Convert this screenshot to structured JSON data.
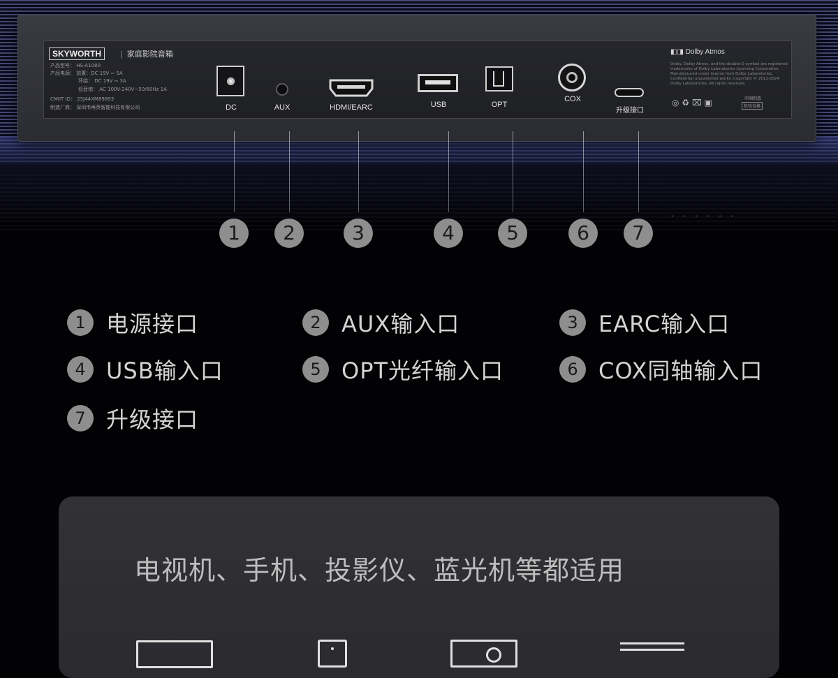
{
  "soundbar": {
    "brand": "SKYWORTH",
    "product_name": "家庭影院音箱",
    "specs": [
      "产品型号：  HS-A1080",
      "产品电源：  前置：DC 19V ⎓ 5A",
      "环绕：  DC 19V ⎓ 3A",
      "低音炮：  AC 100V-240V~50/60Hz 1A",
      "CMIIT ID：  25J44XM89893",
      "制造厂商：  深圳市再英智能科技有限公司"
    ],
    "dolby_logo": "Dolby Atmos",
    "legal_text": "Dolby, Dolby Atmos, and the double-D symbol are registered trademarks of Dolby Laboratories Licensing Corporation. Manufactured under license from Dolby Laboratories. Confidential unpublished works. Copyright © 2012-2024 Dolby Laboratories. All rights reserved.",
    "cert_made_in": "中国制造",
    "cert_check": "检验合格",
    "ports": {
      "dc": "DC",
      "aux": "AUX",
      "hdmi": "HDMI/EARC",
      "usb": "USB",
      "opt": "OPT",
      "cox": "COX",
      "upgrade": "升级接口"
    }
  },
  "callout_numbers": [
    "1",
    "2",
    "3",
    "4",
    "5",
    "6",
    "7"
  ],
  "legend": [
    {
      "num": "1",
      "text": "电源接口"
    },
    {
      "num": "2",
      "text": "AUX输入口"
    },
    {
      "num": "3",
      "text": "EARC输入口"
    },
    {
      "num": "4",
      "text": "USB输入口"
    },
    {
      "num": "5",
      "text": "OPT光纤输入口"
    },
    {
      "num": "6",
      "text": "COX同轴输入口"
    },
    {
      "num": "7",
      "text": "升级接口"
    }
  ],
  "compat": {
    "title": "电视机、手机、投影仪、蓝光机等都适用",
    "icons": [
      "tv-icon",
      "phone-icon",
      "projector-icon",
      "bluray-player-icon"
    ]
  }
}
